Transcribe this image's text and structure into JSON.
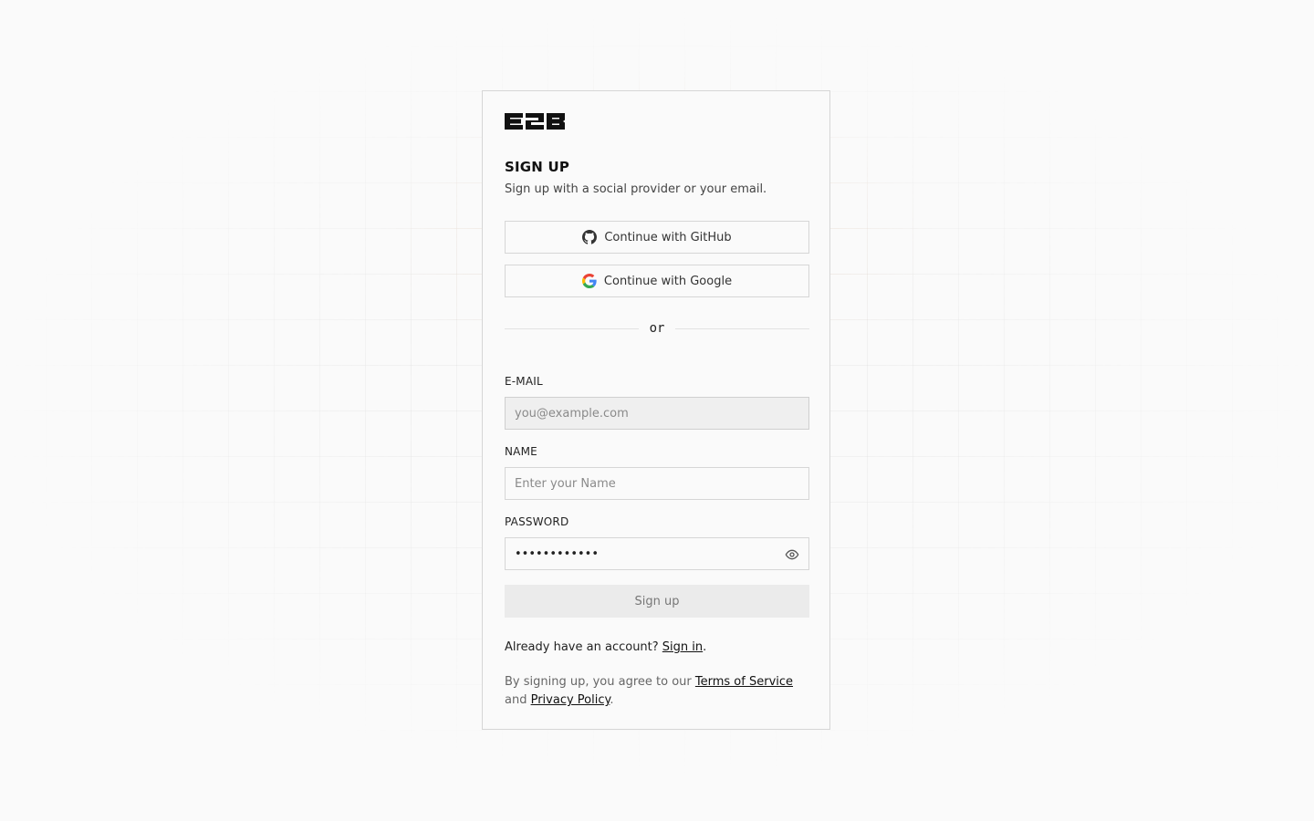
{
  "brand": {
    "logo_text": "E2B"
  },
  "header": {
    "title": "SIGN UP",
    "subtitle": "Sign up with a social provider or your email."
  },
  "social": {
    "github_label": "Continue with GitHub",
    "google_label": "Continue with Google"
  },
  "divider": {
    "text": "or"
  },
  "form": {
    "email": {
      "label": "E-MAIL",
      "placeholder": "you@example.com",
      "value": ""
    },
    "name": {
      "label": "NAME",
      "placeholder": "Enter your Name",
      "value": ""
    },
    "password": {
      "label": "PASSWORD",
      "value": "••••••••••••"
    },
    "submit_label": "Sign up"
  },
  "footer": {
    "signin_prefix": "Already have an account? ",
    "signin_link": "Sign in",
    "signin_suffix": ".",
    "terms_prefix": "By signing up, you agree to our ",
    "terms_link": "Terms of Service",
    "terms_and": " and ",
    "privacy_link": "Privacy Policy",
    "privacy_suffix": "."
  },
  "colors": {
    "background": "#fafafa",
    "border": "#d6d6d6",
    "text": "#111111",
    "muted": "#666666",
    "accent_grid": "#ff963c"
  }
}
